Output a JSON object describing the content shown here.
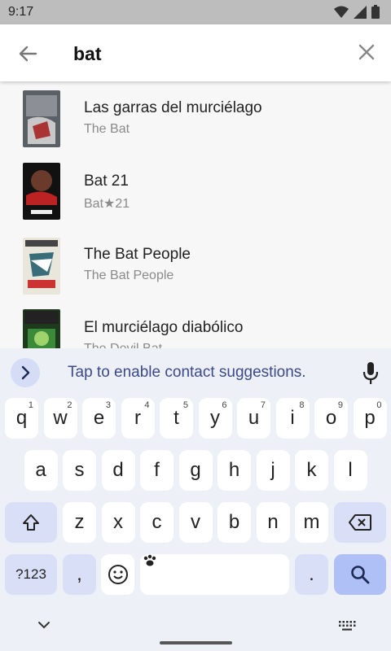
{
  "status_bar": {
    "time": "9:17"
  },
  "search": {
    "query": "bat"
  },
  "results": [
    {
      "title": "Las garras del murciélago",
      "subtitle": "The Bat"
    },
    {
      "title": "Bat 21",
      "subtitle": "Bat★21"
    },
    {
      "title": "The Bat People",
      "subtitle": "The Bat People"
    },
    {
      "title": "El murciélago diabólico",
      "subtitle": "The Devil Bat"
    }
  ],
  "keyboard": {
    "suggestion": "Tap to enable contact suggestions.",
    "row1": [
      {
        "k": "q",
        "h": "1"
      },
      {
        "k": "w",
        "h": "2"
      },
      {
        "k": "e",
        "h": "3"
      },
      {
        "k": "r",
        "h": "4"
      },
      {
        "k": "t",
        "h": "5"
      },
      {
        "k": "y",
        "h": "6"
      },
      {
        "k": "u",
        "h": "7"
      },
      {
        "k": "i",
        "h": "8"
      },
      {
        "k": "o",
        "h": "9"
      },
      {
        "k": "p",
        "h": "0"
      }
    ],
    "row2": [
      "a",
      "s",
      "d",
      "f",
      "g",
      "h",
      "j",
      "k",
      "l"
    ],
    "row3": [
      "z",
      "x",
      "c",
      "v",
      "b",
      "n",
      "m"
    ],
    "symbols_label": "?123",
    "comma_label": ",",
    "period_label": "."
  },
  "colors": {
    "accent": "#aec0f5",
    "function_key": "#d8dff7",
    "keyboard_bg": "#eef0f7"
  },
  "icons": [
    "back-arrow-icon",
    "close-icon",
    "wifi-icon",
    "signal-icon",
    "battery-icon",
    "chevron-right-icon",
    "mic-icon",
    "shift-icon",
    "backspace-icon",
    "emoji-icon",
    "paw-icon",
    "search-icon",
    "chevron-down-icon",
    "keyboard-icon"
  ]
}
